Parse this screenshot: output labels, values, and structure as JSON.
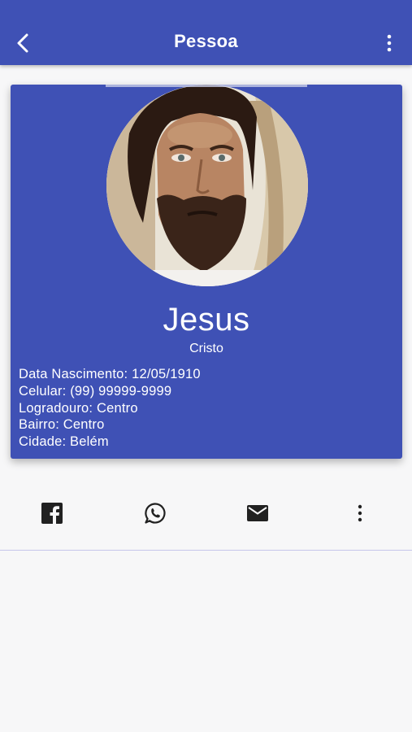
{
  "appbar": {
    "title": "Pessoa",
    "back_icon": "chevron-left-icon",
    "menu_icon": "more-vertical-icon",
    "color": "#3f51b5"
  },
  "person": {
    "first_name": "Jesus",
    "last_name": "Cristo",
    "details": [
      "Data Nascimento: 12/05/1910",
      "Celular: (99) 99999-9999",
      "Logradouro: Centro",
      "Bairro: Centro",
      "Cidade: Belém"
    ]
  },
  "actions": [
    {
      "icon": "facebook-icon"
    },
    {
      "icon": "whatsapp-icon"
    },
    {
      "icon": "email-icon"
    },
    {
      "icon": "more-vertical-icon"
    }
  ]
}
